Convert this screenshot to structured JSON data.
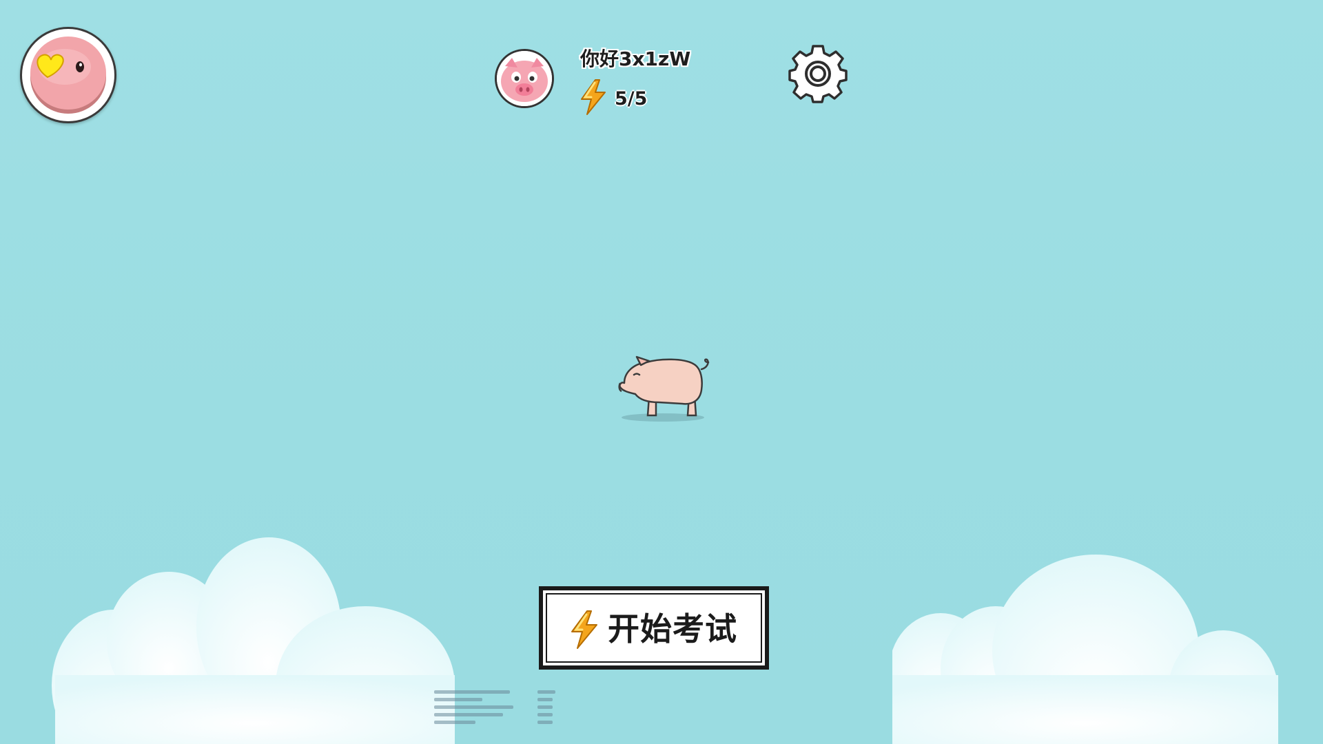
{
  "header": {
    "player_name": "你好3x1zW",
    "energy": "5/5"
  },
  "main": {
    "start_button_label": "开始考试"
  },
  "icons": {
    "top_left": "pig-heart-icon",
    "avatar": "pig-face-avatar",
    "energy": "lightning-icon",
    "settings": "gear-icon",
    "character": "pig-character"
  },
  "colors": {
    "background": "#9bdee3",
    "pig_pink": "#f7b6b4",
    "heart_yellow": "#ffe81a",
    "energy_orange": "#f4a51c"
  }
}
